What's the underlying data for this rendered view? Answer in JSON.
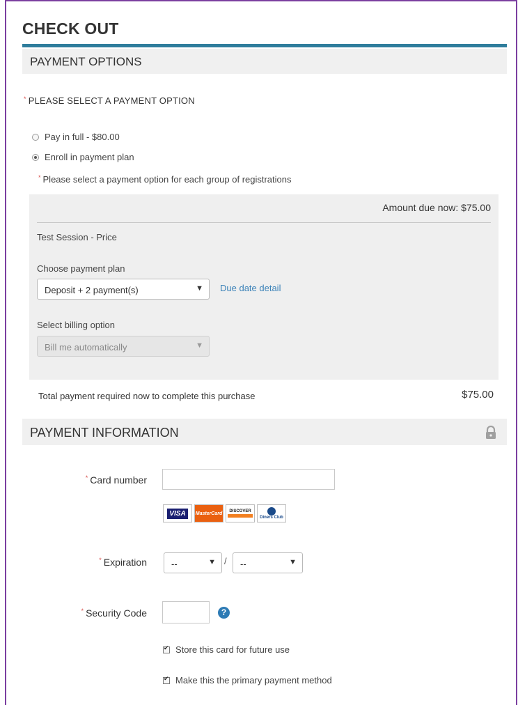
{
  "page": {
    "title": "CHECK OUT"
  },
  "payment_options": {
    "header": "PAYMENT OPTIONS",
    "prompt": "PLEASE SELECT A PAYMENT OPTION",
    "options": [
      {
        "label": "Pay in full - $80.00",
        "selected": false
      },
      {
        "label": "Enroll in payment plan",
        "selected": true
      }
    ],
    "group_note": "Please select a payment option for each group of registrations",
    "plan": {
      "amount_due_now": "Amount due now: $75.00",
      "session_name": "Test Session - Price",
      "choose_label": "Choose payment plan",
      "plan_value": "Deposit + 2 payment(s)",
      "due_date_link": "Due date detail",
      "billing_label": "Select billing option",
      "billing_value": "Bill me automatically"
    },
    "total_label": "Total payment required now to complete this purchase",
    "total_value": "$75.00"
  },
  "payment_information": {
    "header": "PAYMENT INFORMATION",
    "card_number_label": "Card number",
    "card_number_value": "",
    "accepted_cards": [
      "VISA",
      "MasterCard",
      "DISCOVER",
      "Diners Club"
    ],
    "expiration_label": "Expiration",
    "exp_month_value": "--",
    "exp_year_value": "--",
    "exp_separator": "/",
    "security_code_label": "Security Code",
    "security_code_value": "",
    "help_glyph": "?",
    "store_card_label": "Store this card for future use",
    "store_card_checked": true,
    "primary_method_label": "Make this the primary payment method",
    "primary_method_checked": true
  },
  "icons": {
    "lock": "lock-icon",
    "help": "help-icon",
    "caret": "chevron-down-icon"
  },
  "colors": {
    "accent_rule": "#2f7d9c",
    "link": "#3b82b8",
    "required": "#d9534f",
    "frame": "#7b3fa0"
  }
}
